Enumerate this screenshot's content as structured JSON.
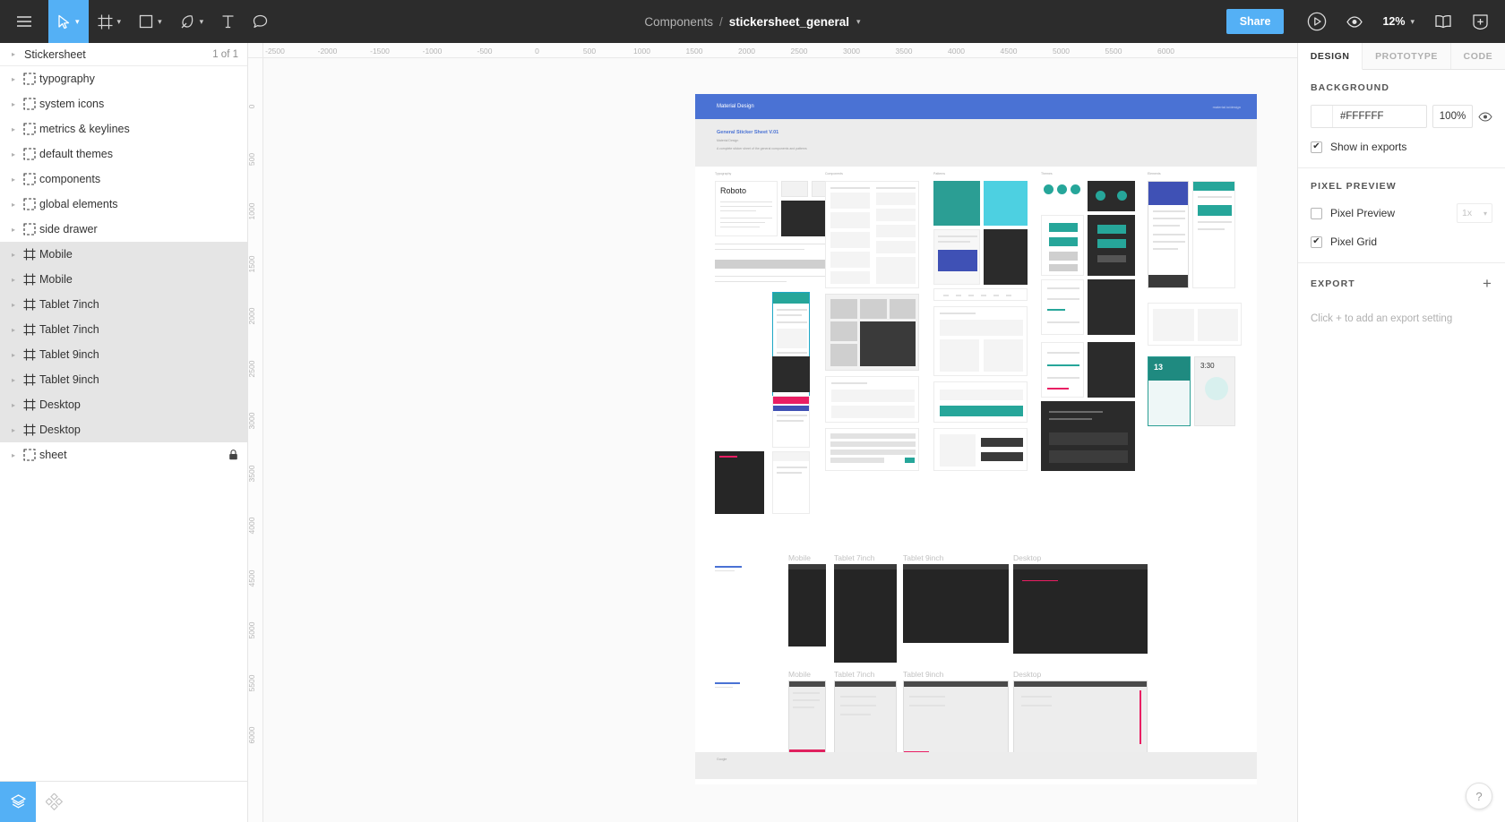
{
  "toolbar": {
    "menu_icon": "hamburger-menu-icon",
    "tools": [
      {
        "name": "move-tool",
        "icon": "cursor-icon",
        "caret": "▾",
        "active": true
      },
      {
        "name": "frame-tool",
        "icon": "frame-icon",
        "caret": "▾",
        "active": false
      },
      {
        "name": "shape-tool",
        "icon": "square-icon",
        "caret": "▾",
        "active": false
      },
      {
        "name": "pen-tool",
        "icon": "pen-icon",
        "caret": "▾",
        "active": false
      },
      {
        "name": "text-tool",
        "icon": "text-icon",
        "caret": "",
        "active": false
      },
      {
        "name": "comment-tool",
        "icon": "comment-icon",
        "caret": "",
        "active": false
      }
    ],
    "breadcrumb": {
      "parent": "Components",
      "separator": "/",
      "current": "stickersheet_general",
      "caret": "▾"
    },
    "share_label": "Share",
    "present_icon": "play-circle-icon",
    "view_icon": "eye-icon",
    "zoom_level": "12%",
    "zoom_caret": "▾",
    "library_icon": "book-icon",
    "add_icon": "plus-shield-icon",
    "accent_color": "#54b0f5",
    "bar_color": "#2c2c2c"
  },
  "left_panel": {
    "page": {
      "name": "Stickersheet",
      "count": "1 of 1",
      "disclosure": "▸"
    },
    "layers": [
      {
        "name": "typography",
        "icon": "group-icon",
        "selected": false,
        "locked": false
      },
      {
        "name": "system icons",
        "icon": "group-icon",
        "selected": false,
        "locked": false
      },
      {
        "name": "metrics & keylines",
        "icon": "group-icon",
        "selected": false,
        "locked": false
      },
      {
        "name": "default themes",
        "icon": "group-icon",
        "selected": false,
        "locked": false
      },
      {
        "name": "components",
        "icon": "group-icon",
        "selected": false,
        "locked": false
      },
      {
        "name": "global elements",
        "icon": "group-icon",
        "selected": false,
        "locked": false
      },
      {
        "name": "side drawer",
        "icon": "group-icon",
        "selected": false,
        "locked": false
      },
      {
        "name": "Mobile",
        "icon": "frame-icon",
        "selected": true,
        "locked": false
      },
      {
        "name": "Mobile",
        "icon": "frame-icon",
        "selected": true,
        "locked": false
      },
      {
        "name": "Tablet 7inch",
        "icon": "frame-icon",
        "selected": true,
        "locked": false
      },
      {
        "name": "Tablet 7inch",
        "icon": "frame-icon",
        "selected": true,
        "locked": false
      },
      {
        "name": "Tablet 9inch",
        "icon": "frame-icon",
        "selected": true,
        "locked": false
      },
      {
        "name": "Tablet 9inch",
        "icon": "frame-icon",
        "selected": true,
        "locked": false
      },
      {
        "name": "Desktop",
        "icon": "frame-icon",
        "selected": true,
        "locked": false
      },
      {
        "name": "Desktop",
        "icon": "frame-icon",
        "selected": true,
        "locked": false
      },
      {
        "name": "sheet",
        "icon": "group-icon",
        "selected": false,
        "locked": true
      }
    ],
    "footer": [
      {
        "name": "layers-tab",
        "icon": "layers-icon",
        "active": true
      },
      {
        "name": "assets-tab",
        "icon": "components-icon",
        "active": false
      }
    ]
  },
  "rulers": {
    "horizontal": [
      "-2500",
      "-2000",
      "-1500",
      "-1000",
      "-500",
      "0",
      "500",
      "1000",
      "1500",
      "2000",
      "2500",
      "3000",
      "3500",
      "4000",
      "4500",
      "5000",
      "5500",
      "6000"
    ],
    "vertical": [
      "0",
      "500",
      "1000",
      "1500",
      "2000",
      "2500",
      "3000",
      "3500",
      "4000",
      "4500",
      "5000",
      "5500",
      "6000"
    ]
  },
  "canvas": {
    "sheet_header": "Material Design",
    "sheet_header_right": "material.io/design",
    "sheet_subtitle": "General Sticker Sheet V.01",
    "sheet_meta_1": "Material Design",
    "sheet_meta_2": "A complete sticker sheet of the general components and patterns",
    "column_labels": [
      "Typography",
      "Components",
      "Patterns",
      "Themes",
      "Elements"
    ],
    "device_rows": [
      {
        "labels": [
          "Mobile",
          "Tablet 7inch",
          "Tablet 9inch",
          "Desktop"
        ]
      },
      {
        "labels": [
          "Mobile",
          "Tablet 7inch",
          "Tablet 9inch",
          "Desktop"
        ]
      }
    ],
    "footer_label": "Google"
  },
  "right_panel": {
    "tabs": [
      {
        "label": "DESIGN",
        "active": true
      },
      {
        "label": "PROTOTYPE",
        "active": false
      },
      {
        "label": "CODE",
        "active": false
      }
    ],
    "background": {
      "title": "BACKGROUND",
      "color": "#FFFFFF",
      "opacity": "100%",
      "visibility_icon": "eye-icon",
      "show_in_exports": {
        "label": "Show in exports",
        "checked": true,
        "mark": "✔"
      }
    },
    "pixel_preview": {
      "title": "PIXEL PREVIEW",
      "preview": {
        "label": "Pixel Preview",
        "checked": false,
        "mark": ""
      },
      "scale": "1x",
      "scale_caret": "▾",
      "grid": {
        "label": "Pixel Grid",
        "checked": true,
        "mark": "✔"
      }
    },
    "export": {
      "title": "EXPORT",
      "add": "+",
      "empty_text": "Click + to add an export setting"
    }
  },
  "help": {
    "label": "?"
  }
}
